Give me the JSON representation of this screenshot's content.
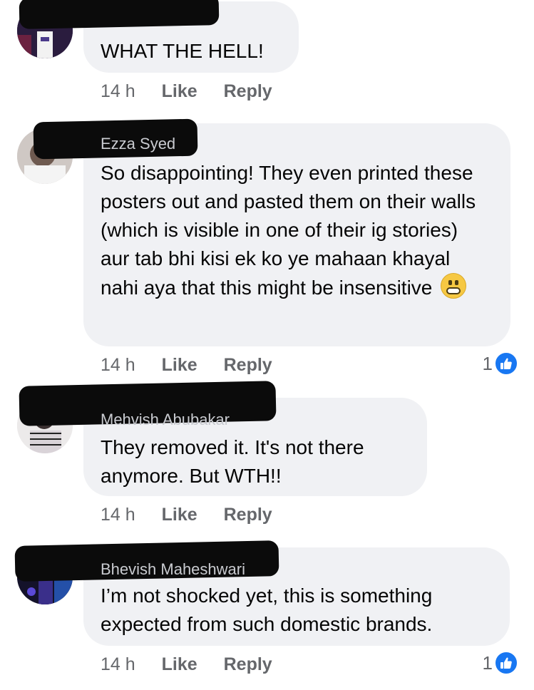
{
  "comments": [
    {
      "author": "",
      "text": "WHAT THE HELL!",
      "time": "14 h",
      "like_label": "Like",
      "reply_label": "Reply",
      "reaction_count": ""
    },
    {
      "author": "Ezza Syed",
      "text": "So disappointing! They even printed these posters out and pasted them on their walls (which is visible in one of their ig stories) aur tab bhi kisi ek ko ye mahaan khayal nahi aya that this might be insensitive",
      "emoji": "grimacing-face-emoji",
      "time": "14 h",
      "like_label": "Like",
      "reply_label": "Reply",
      "reaction_count": "1"
    },
    {
      "author": "Mehvish Abubakar",
      "text": "They removed it. It's not there anymore. But WTH!!",
      "time": "14 h",
      "like_label": "Like",
      "reply_label": "Reply",
      "reaction_count": ""
    },
    {
      "author": "Bhevish Maheshwari",
      "text": "I’m not shocked yet, this is something expected from such domestic brands.",
      "time": "14 h",
      "like_label": "Like",
      "reply_label": "Reply",
      "reaction_count": "1"
    }
  ],
  "colors": {
    "bubble": "#f0f1f4",
    "meta_text": "#65676b",
    "like_blue": "#1877f2"
  }
}
